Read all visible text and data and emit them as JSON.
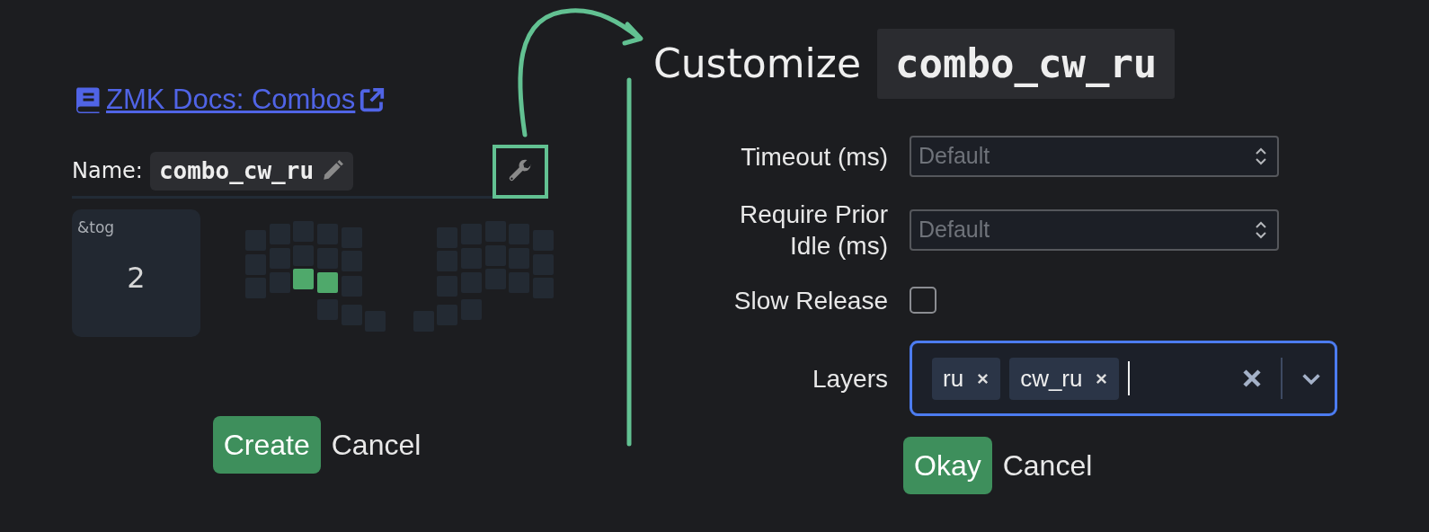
{
  "doc_link": {
    "text": "ZMK Docs: Combos"
  },
  "name": {
    "label": "Name:",
    "value": "combo_cw_ru"
  },
  "binding": {
    "behavior": "&tog",
    "param": "2"
  },
  "keys": [
    {
      "selected": false
    },
    {
      "selected": false
    },
    {
      "selected": false
    },
    {
      "selected": false
    },
    {
      "selected": false
    },
    {
      "selected": false
    },
    {
      "selected": false
    },
    {
      "selected": false
    },
    {
      "selected": true
    },
    {
      "selected": false
    },
    {
      "selected": false
    },
    {
      "selected": true
    },
    {
      "selected": false
    },
    {
      "selected": false
    },
    {
      "selected": false
    },
    {
      "selected": false
    },
    {
      "selected": false
    },
    {
      "selected": false
    },
    {
      "selected": false
    },
    {
      "selected": false
    },
    {
      "selected": false
    },
    {
      "selected": false
    },
    {
      "selected": false
    },
    {
      "selected": false
    },
    {
      "selected": false
    },
    {
      "selected": false
    },
    {
      "selected": false
    },
    {
      "selected": false
    },
    {
      "selected": false
    },
    {
      "selected": false
    },
    {
      "selected": false
    },
    {
      "selected": false
    },
    {
      "selected": false
    },
    {
      "selected": false
    },
    {
      "selected": false
    },
    {
      "selected": false
    }
  ],
  "left_buttons": [
    {
      "kind": "primary",
      "label": "Create"
    },
    {
      "kind": "plain",
      "label": "Cancel"
    }
  ],
  "customize": {
    "title": "Customize",
    "combo": "combo_cw_ru"
  },
  "fields": [
    {
      "kind": "number",
      "label": "Timeout (ms)",
      "placeholder": "Default"
    },
    {
      "kind": "number",
      "label": "Require Prior Idle (ms)",
      "placeholder": "Default"
    },
    {
      "kind": "checkbox",
      "label": "Slow Release",
      "checked": false
    },
    {
      "kind": "multiselect",
      "label": "Layers",
      "tags": [
        "ru",
        "cw_ru"
      ]
    }
  ],
  "right_buttons": [
    {
      "kind": "primary",
      "label": "Okay"
    },
    {
      "kind": "plain",
      "label": "Cancel"
    }
  ]
}
